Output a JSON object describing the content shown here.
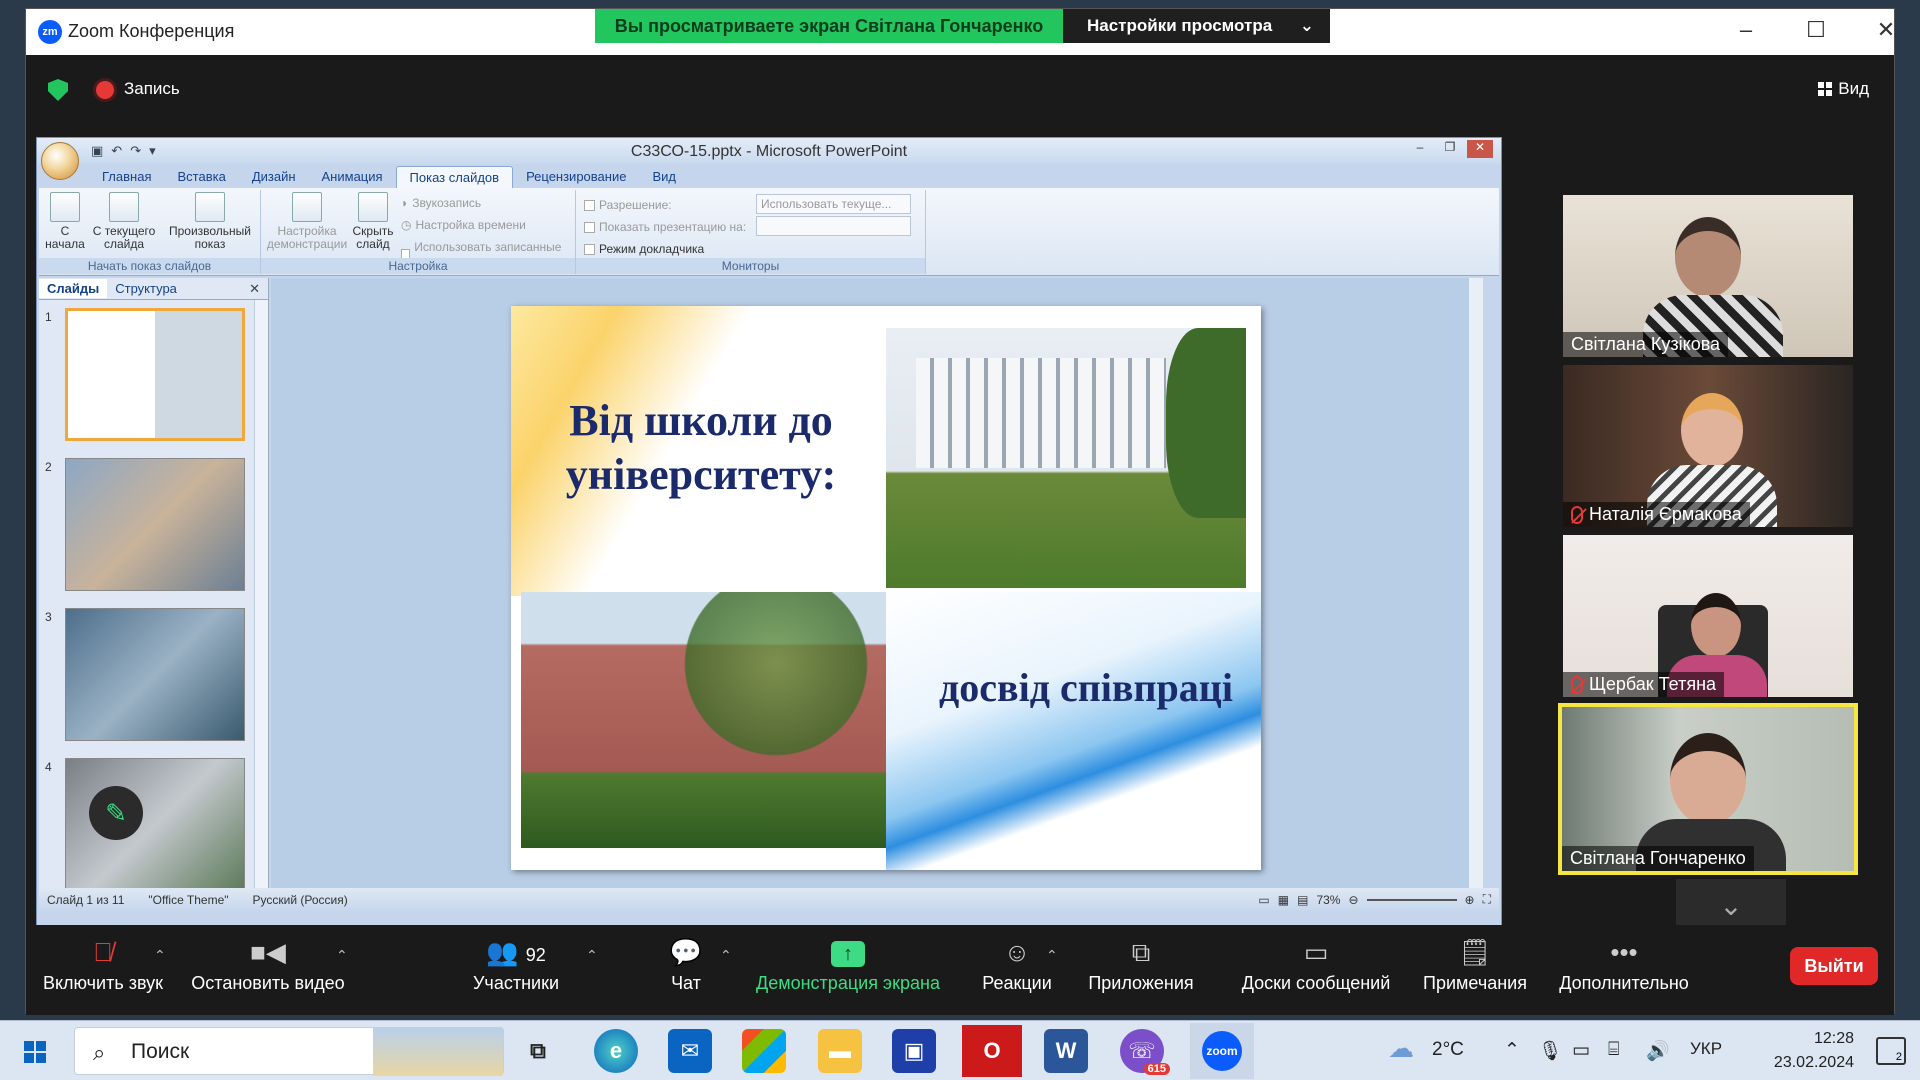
{
  "window": {
    "title": "Zoom Конференция"
  },
  "banner": {
    "viewing": "Вы просматриваете экран Світлана Гончаренко",
    "view_options": "Настройки просмотра"
  },
  "topbar": {
    "record_label": "Запись",
    "view_label": "Вид"
  },
  "powerpoint": {
    "title": "С33СО-15.pptx - Microsoft PowerPoint",
    "tabs": [
      "Главная",
      "Вставка",
      "Дизайн",
      "Анимация",
      "Показ слайдов",
      "Рецензирование",
      "Вид"
    ],
    "active_tab": "Показ слайдов",
    "ribbon": {
      "group1": {
        "label": "Начать показ слайдов",
        "buttons": [
          "С начала",
          "С текущего слайда",
          "Произвольный показ"
        ]
      },
      "group2": {
        "label": "Настройка",
        "buttons": [
          "Настройка демонстрации",
          "Скрыть слайд"
        ],
        "options": [
          "Звукозапись",
          "Настройка времени",
          "Использовать записанные времена"
        ]
      },
      "group3": {
        "label": "Мониторы",
        "resolution_label": "Разрешение:",
        "resolution_value": "Использовать текуще...",
        "show_on_label": "Показать презентацию на:",
        "presenter_view": "Режим докладчика"
      }
    },
    "side_tabs": [
      "Слайды",
      "Структура"
    ],
    "slide_numbers": [
      "1",
      "2",
      "3",
      "4"
    ],
    "slide": {
      "title": "Від школи до університету:",
      "subtitle": "досвід співпраці"
    },
    "status": {
      "slide": "Слайд 1 из 11",
      "theme": "\"Office Theme\"",
      "language": "Русский (Россия)",
      "zoom": "73%"
    }
  },
  "participants": [
    {
      "name": "Світлана Кузікова",
      "muted": false
    },
    {
      "name": "Наталія  Єрмакова",
      "muted": true
    },
    {
      "name": "Щербак Тетяна",
      "muted": true
    },
    {
      "name": "Світлана Гончаренко",
      "muted": false,
      "speaking": true
    }
  ],
  "toolbar": {
    "unmute": "Включить звук",
    "stop_video": "Остановить видео",
    "participants": "Участники",
    "participants_count": "92",
    "chat": "Чат",
    "share": "Демонстрация экрана",
    "reactions": "Реакции",
    "apps": "Приложения",
    "whiteboards": "Доски сообщений",
    "notes": "Примечания",
    "more": "Дополнительно",
    "leave": "Выйти"
  },
  "taskbar": {
    "search": "Поиск",
    "weather": "2°C",
    "language": "УКР",
    "time": "12:28",
    "date": "23.02.2024",
    "badge": "615",
    "notifications": "2"
  },
  "colors": {
    "zoom_blue": "#0b5cff",
    "share_green": "#3ddc84",
    "leave_red": "#e02828",
    "speaker_yellow": "#f5e642"
  }
}
